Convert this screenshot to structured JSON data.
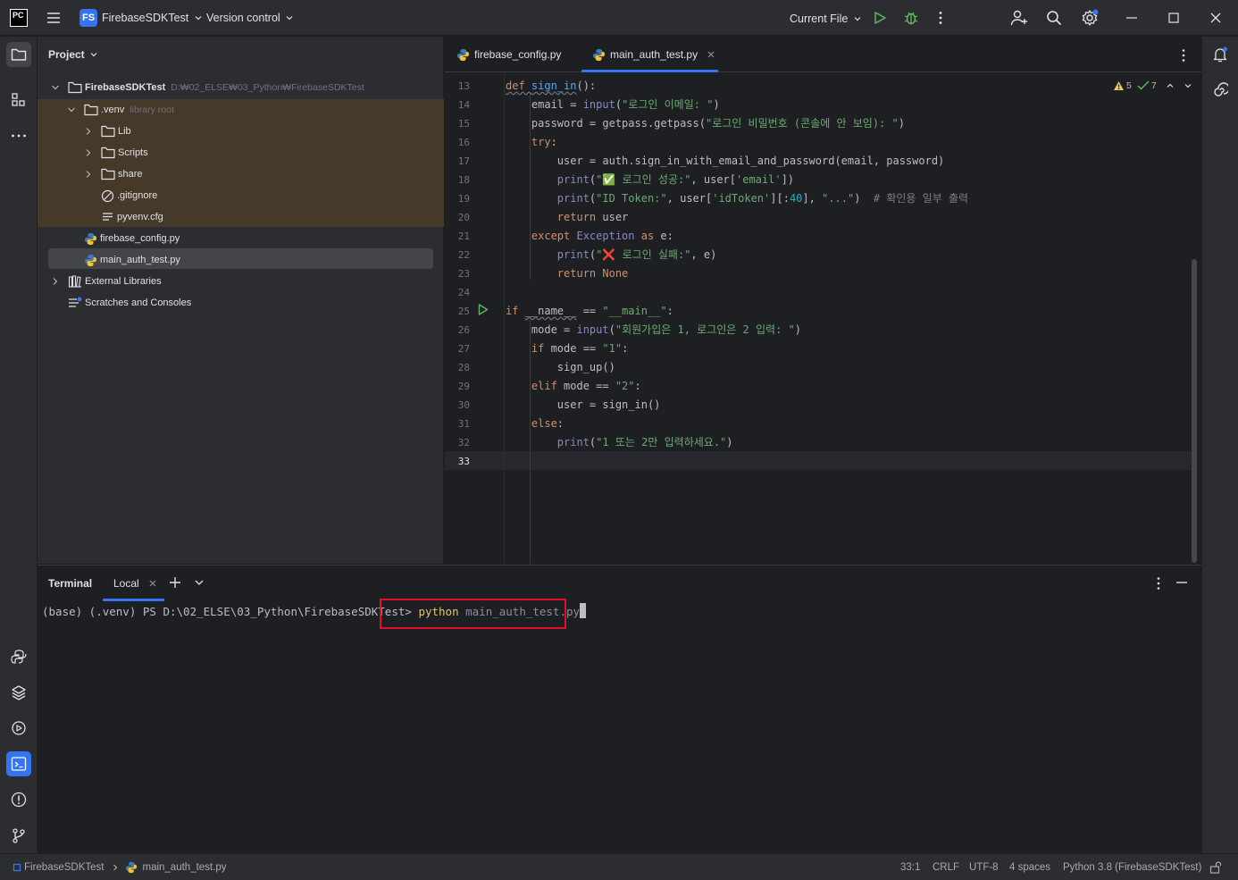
{
  "titlebar": {
    "app_logo": "PC",
    "project_badge": "FS",
    "project_name": "FirebaseSDKTest",
    "vcs": "Version control",
    "run_config": "Current File"
  },
  "project_panel": {
    "title": "Project",
    "tree": [
      {
        "label": "FirebaseSDKTest",
        "hint": "D:₩02_ELSE₩03_Python₩FirebaseSDKTest"
      },
      {
        "label": ".venv",
        "hint": "library root"
      },
      {
        "label": "Lib"
      },
      {
        "label": "Scripts"
      },
      {
        "label": "share"
      },
      {
        "label": ".gitignore"
      },
      {
        "label": "pyvenv.cfg"
      },
      {
        "label": "firebase_config.py"
      },
      {
        "label": "main_auth_test.py"
      },
      {
        "label": "External Libraries"
      },
      {
        "label": "Scratches and Consoles"
      }
    ]
  },
  "editor": {
    "tabs": [
      {
        "label": "firebase_config.py"
      },
      {
        "label": "main_auth_test.py"
      }
    ],
    "warnings": "5",
    "checks": "7",
    "line_numbers": [
      "13",
      "14",
      "15",
      "16",
      "17",
      "18",
      "19",
      "20",
      "21",
      "22",
      "23",
      "24",
      "25",
      "26",
      "27",
      "28",
      "29",
      "30",
      "31",
      "32",
      "33"
    ],
    "code": {
      "l13a": "def ",
      "l13b": "sign_in",
      "l13c": "():",
      "l14a": "    email = ",
      "l14b": "input",
      "l14c": "(",
      "l14d": "\"로그인 이메일: \"",
      "l14e": ")",
      "l15a": "    password = getpass.getpass(",
      "l15b": "\"로그인 비밀번호 (콘솔에 안 보임): \"",
      "l15c": ")",
      "l16a": "    try",
      "l16b": ":",
      "l17a": "        user = auth.sign_in_with_email_and_password(email, password)",
      "l18a": "        ",
      "l18b": "print",
      "l18c": "(",
      "l18d": "\"✅ 로그인 성공:\"",
      "l18e": ", user[",
      "l18f": "'email'",
      "l18g": "])",
      "l19a": "        ",
      "l19b": "print",
      "l19c": "(",
      "l19d": "\"ID Token:\"",
      "l19e": ", user[",
      "l19f": "'idToken'",
      "l19g": "][:",
      "l19h": "40",
      "l19i": "], ",
      "l19j": "\"...\"",
      "l19k": ")  ",
      "l19l": "# 확인용 일부 출력",
      "l20a": "        return ",
      "l20b": "user",
      "l21a": "    except ",
      "l21b": "Exception ",
      "l21c": "as ",
      "l21d": "e:",
      "l22a": "        ",
      "l22b": "print",
      "l22c": "(",
      "l22d": "\"❌ 로그인 실패:\"",
      "l22e": ", e)",
      "l23a": "        return ",
      "l23b": "None",
      "l25a": "if ",
      "l25b": "__name__",
      "l25c": " == ",
      "l25d": "\"__main__\"",
      "l25e": ":",
      "l26a": "    mode = ",
      "l26b": "input",
      "l26c": "(",
      "l26d": "\"회원가입은 1, 로그인은 2 입력: \"",
      "l26e": ")",
      "l27a": "    if ",
      "l27b": "mode == ",
      "l27c": "\"1\"",
      "l27d": ":",
      "l28a": "        sign_up()",
      "l29a": "    elif ",
      "l29b": "mode == ",
      "l29c": "\"2\"",
      "l29d": ":",
      "l30a": "        user = sign_in()",
      "l31a": "    else",
      "l31b": ":",
      "l32a": "        ",
      "l32b": "print",
      "l32c": "(",
      "l32d": "\"1 또는 2만 입력하세요.\"",
      "l32e": ")"
    }
  },
  "terminal": {
    "title": "Terminal",
    "tab": "Local",
    "prompt": "(base) (.venv) PS D:\\02_ELSE\\03_Python\\FirebaseSDKTest> ",
    "command": "python",
    "args": " main_auth_test.py"
  },
  "statusbar": {
    "breadcrumb_project": "FirebaseSDKTest",
    "breadcrumb_file": "main_auth_test.py",
    "position": "33:1",
    "line_sep": "CRLF",
    "encoding": "UTF-8",
    "indent": "4 spaces",
    "interpreter": "Python 3.8 (FirebaseSDKTest)"
  },
  "colors": {
    "accent": "#3574f0",
    "highlight_box": "#e0102a",
    "run_green": "#5fb85f",
    "venv_bg": "#45392a"
  }
}
